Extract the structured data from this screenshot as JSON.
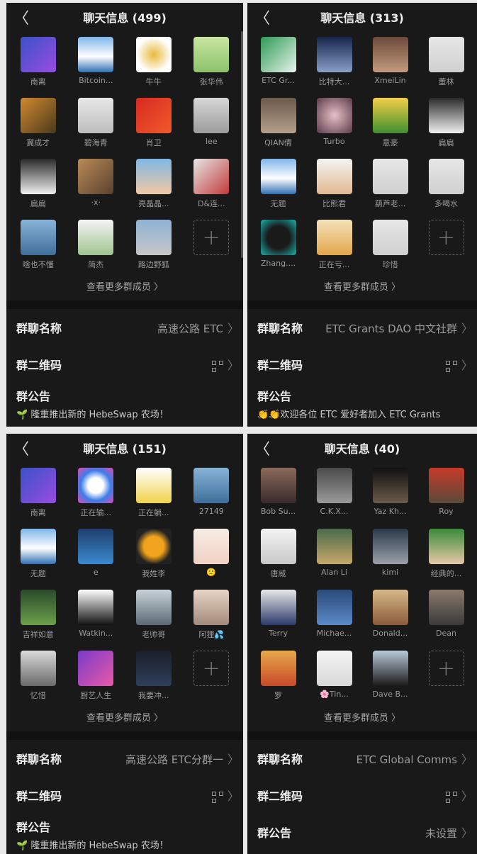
{
  "panels": [
    {
      "title": "聊天信息 (499)",
      "members": [
        {
          "name": "南离",
          "bg": "linear-gradient(135deg,#3a52c9,#9b4be0)"
        },
        {
          "name": "Bitcoin...",
          "bg": "linear-gradient(180deg,#7fb6ea,#ffffff 55%,#2d6fb5)"
        },
        {
          "name": "牛牛",
          "bg": "radial-gradient(circle,#e8b93b,#fff 70%)"
        },
        {
          "name": "张华伟",
          "bg": "linear-gradient(180deg,#c8e6a0,#8cc26b)"
        },
        {
          "name": "冀成才",
          "bg": "linear-gradient(135deg,#d1892f,#4a3a1c)"
        },
        {
          "name": "碧海青",
          "bg": "linear-gradient(180deg,#e8e8e8,#bdbdbd)"
        },
        {
          "name": "肖卫",
          "bg": "linear-gradient(135deg,#d92a22,#f05a2a)"
        },
        {
          "name": "lee",
          "bg": "linear-gradient(180deg,#d7d7d7,#9c9c9c)"
        },
        {
          "name": "扁扁",
          "bg": "linear-gradient(180deg,#2a2a2a,#f0f0f0)"
        },
        {
          "name": "·x·",
          "bg": "linear-gradient(135deg,#b98b56,#5a4030)"
        },
        {
          "name": "亮晶晶...",
          "bg": "linear-gradient(180deg,#7fb7e3,#f3c9a5)"
        },
        {
          "name": "D&连...",
          "bg": "linear-gradient(135deg,#e6e6e6,#c23a3a)"
        },
        {
          "name": "啥也不懂",
          "bg": "linear-gradient(180deg,#88b3d8,#3f6f9a)"
        },
        {
          "name": "简杰",
          "bg": "linear-gradient(180deg,#f4f4f4,#9fc48f)"
        },
        {
          "name": "路边野狐",
          "bg": "linear-gradient(180deg,#8fb2d4,#c7c7c7)"
        }
      ],
      "more_label": "查看更多群成员 〉",
      "group_name_label": "群聊名称",
      "group_name_value": "高速公路 ETC",
      "qr_label": "群二维码",
      "notice_label": "群公告",
      "notice_text": "🌱 隆重推出新的 HebeSwap 农场！"
    },
    {
      "title": "聊天信息 (313)",
      "members": [
        {
          "name": "ETC Gr...",
          "bg": "linear-gradient(135deg,#2e9a55,#e8f4ec)"
        },
        {
          "name": "比特大...",
          "bg": "linear-gradient(180deg,#15244a,#8aa0c8)"
        },
        {
          "name": "XmeiLin",
          "bg": "linear-gradient(180deg,#6b4a3a,#c49a7d)"
        },
        {
          "name": "董林",
          "bg": "linear-gradient(180deg,#e7e7e7,#cfcfcf)"
        },
        {
          "name": "QIAN倩",
          "bg": "linear-gradient(180deg,#6b5a4a,#b39f8a)"
        },
        {
          "name": "Turbo",
          "bg": "radial-gradient(circle,#e9c1c7,#5a3a4a)"
        },
        {
          "name": "意豪",
          "bg": "linear-gradient(180deg,#f2d04a,#3f8f2f)"
        },
        {
          "name": "扁扁",
          "bg": "linear-gradient(180deg,#2a2a2a,#f0f0f0)"
        },
        {
          "name": "无题",
          "bg": "linear-gradient(180deg,#7fb6ea,#ffffff 55%,#2d6fb5)"
        },
        {
          "name": "比熊君",
          "bg": "linear-gradient(180deg,#f4f4f4,#e2b88f)"
        },
        {
          "name": "葫芦老...",
          "bg": "linear-gradient(180deg,#e7e7e7,#cfcfcf)"
        },
        {
          "name": "多喝水",
          "bg": "linear-gradient(180deg,#e7e7e7,#cfcfcf)"
        },
        {
          "name": "Zhang....",
          "bg": "radial-gradient(circle,#1a1a1a 45%,#19b4b0)"
        },
        {
          "name": "正在亏...",
          "bg": "linear-gradient(180deg,#f3e2b8,#e2a64a)"
        },
        {
          "name": "珍惜",
          "bg": "linear-gradient(180deg,#e7e7e7,#cfcfcf)"
        }
      ],
      "more_label": "查看更多群成员 〉",
      "group_name_label": "群聊名称",
      "group_name_value": "ETC Grants DAO 中文社群",
      "qr_label": "群二维码",
      "notice_label": "群公告",
      "notice_text": "👏👏欢迎各位 ETC 爱好者加入 ETC Grants"
    },
    {
      "title": "聊天信息 (151)",
      "members": [
        {
          "name": "南离",
          "bg": "linear-gradient(135deg,#3a52c9,#9b4be0)"
        },
        {
          "name": "正在输...",
          "bg": "radial-gradient(circle,#ffffff 30%,#3b7de8 60%,#e848b8)"
        },
        {
          "name": "正在躺...",
          "bg": "linear-gradient(180deg,#ffffff,#f2d24a)"
        },
        {
          "name": "27149",
          "bg": "linear-gradient(180deg,#88b3d8,#3f6f9a)"
        },
        {
          "name": "无题",
          "bg": "linear-gradient(180deg,#7fb6ea,#ffffff 55%,#2d6fb5)"
        },
        {
          "name": "e",
          "bg": "linear-gradient(180deg,#1d3f6e,#3a8ad0)"
        },
        {
          "name": "我姓李",
          "bg": "radial-gradient(circle,#f0a31c 40%,#222 70%)"
        },
        {
          "name": "🙂",
          "bg": "linear-gradient(180deg,#f6ece4,#f1d2c4)"
        },
        {
          "name": "吉祥如意",
          "bg": "linear-gradient(180deg,#2a4a2a,#6ba04a)"
        },
        {
          "name": "Watkin...",
          "bg": "linear-gradient(180deg,#ffffff,#111111)"
        },
        {
          "name": "老帅哥",
          "bg": "linear-gradient(180deg,#c8d2d8,#5a6a74)"
        },
        {
          "name": "阿狸💦",
          "bg": "linear-gradient(180deg,#e8d5c5,#a38a7a)"
        },
        {
          "name": "忆惜",
          "bg": "linear-gradient(180deg,#d9d9d9,#6a6a6a)"
        },
        {
          "name": "厨艺人生",
          "bg": "linear-gradient(135deg,#7a3ac9,#e85aa8)"
        },
        {
          "name": "我要冲...",
          "bg": "linear-gradient(180deg,#1a1f2a,#2f3f5a)"
        }
      ],
      "more_label": "查看更多群成员 〉",
      "group_name_label": "群聊名称",
      "group_name_value": "高速公路 ETC分群一",
      "qr_label": "群二维码",
      "notice_label": "群公告",
      "notice_text": "🌱 隆重推出新的 HebeSwap 农场！"
    },
    {
      "title": "聊天信息 (40)",
      "members": [
        {
          "name": "Bob Su...",
          "bg": "linear-gradient(180deg,#8a6a5a,#3a2a2a)"
        },
        {
          "name": "C.K.X...",
          "bg": "linear-gradient(180deg,#4a4a4a,#9a9a9a)"
        },
        {
          "name": "Yaz Kh...",
          "bg": "linear-gradient(180deg,#111,#6a5a4a)"
        },
        {
          "name": "Roy",
          "bg": "linear-gradient(180deg,#c83a2a,#5a4a3a)"
        },
        {
          "name": "唐威",
          "bg": "linear-gradient(180deg,#f4f4f4,#c8c8c8)"
        },
        {
          "name": "Alan Li",
          "bg": "linear-gradient(180deg,#4a6a4a,#c8a86a)"
        },
        {
          "name": "kimi",
          "bg": "linear-gradient(180deg,#2a3a4a,#9aa0a8)"
        },
        {
          "name": "经典的...",
          "bg": "linear-gradient(180deg,#3a8a3a,#e8c8a8)"
        },
        {
          "name": "Terry",
          "bg": "linear-gradient(180deg,#e8e8e8,#2a3a6a)"
        },
        {
          "name": "Michae...",
          "bg": "linear-gradient(180deg,#2a4a7a,#5a8ac8)"
        },
        {
          "name": "Donald...",
          "bg": "linear-gradient(180deg,#d8b88a,#8a5a3a)"
        },
        {
          "name": "Dean",
          "bg": "linear-gradient(180deg,#8a7a6a,#3a3a3a)"
        },
        {
          "name": "罗",
          "bg": "linear-gradient(180deg,#e8a84a,#c84a2a)"
        },
        {
          "name": "🌸Tin...",
          "bg": "linear-gradient(180deg,#f4f4f4,#d8d8d8)"
        },
        {
          "name": "Dave B...",
          "bg": "linear-gradient(180deg,#b8c8d8,#1a1a1a)"
        }
      ],
      "more_label": "查看更多群成员 〉",
      "group_name_label": "群聊名称",
      "group_name_value": "ETC Global Comms",
      "qr_label": "群二维码",
      "notice_label": "群公告",
      "notice_value": "未设置"
    }
  ],
  "back_icon": "〈",
  "add_icon": "+",
  "chevron": "〉"
}
